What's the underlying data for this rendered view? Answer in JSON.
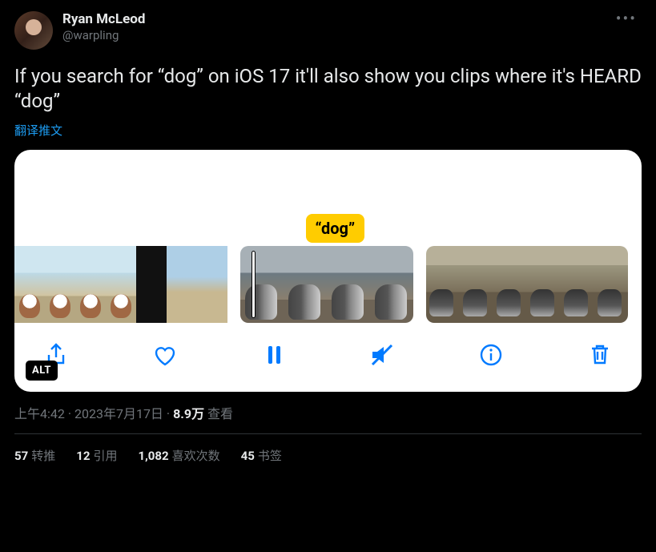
{
  "author": {
    "name": "Ryan McLeod",
    "handle": "@warpling"
  },
  "body": "If you search for “dog” on iOS 17 it'll also show you clips where it's HEARD “dog”",
  "translate_label": "翻译推文",
  "media": {
    "detected_word": "“dog”",
    "alt_badge": "ALT"
  },
  "meta": {
    "time": "上午4:42",
    "sep1": " · ",
    "date": "2023年7月17日",
    "sep2": " · ",
    "views_value": "8.9万",
    "views_label": " 查看"
  },
  "stats": {
    "retweets": {
      "n": "57",
      "label": "转推"
    },
    "quotes": {
      "n": "12",
      "label": "引用"
    },
    "likes": {
      "n": "1,082",
      "label": "喜欢次数"
    },
    "bookmarks": {
      "n": "45",
      "label": "书签"
    }
  }
}
